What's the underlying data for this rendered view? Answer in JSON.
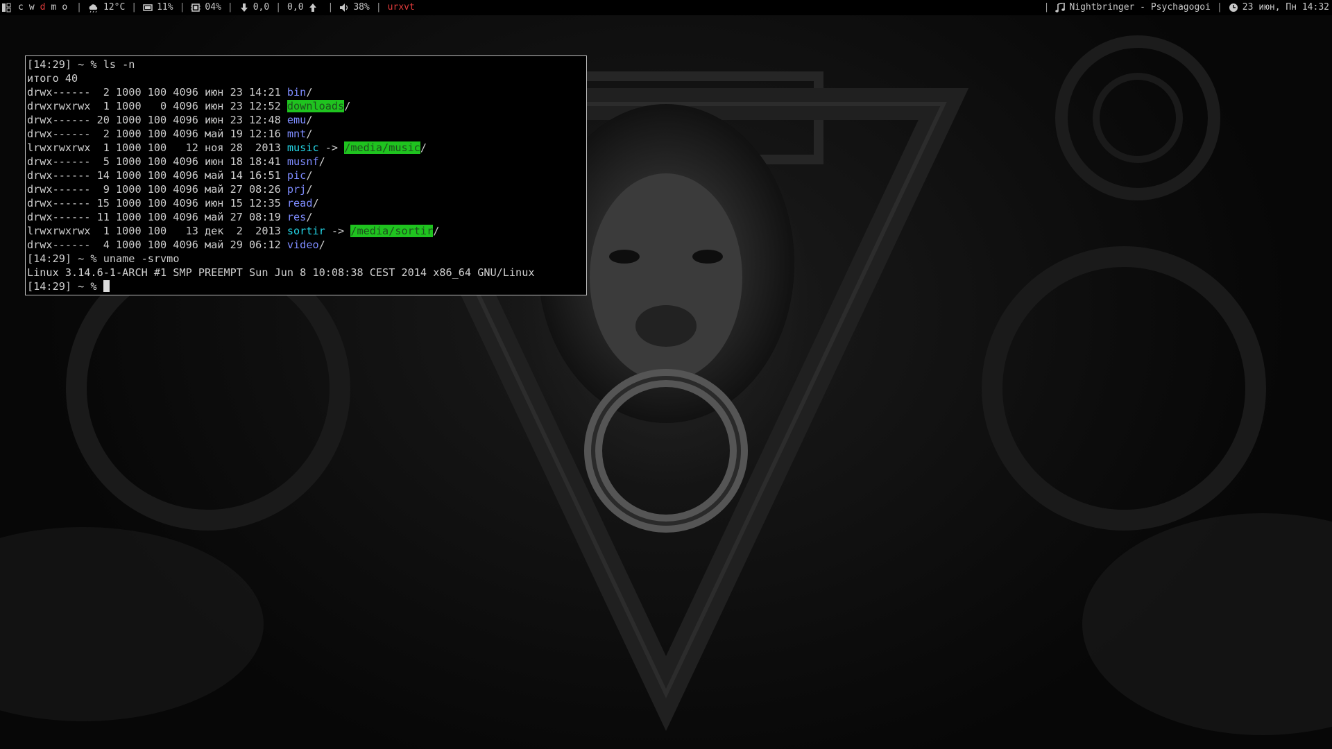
{
  "topbar": {
    "workspaces": [
      {
        "label": "c",
        "active": false
      },
      {
        "label": "w",
        "active": false
      },
      {
        "label": "d",
        "active": true
      },
      {
        "label": "m",
        "active": false
      },
      {
        "label": "o",
        "active": false
      }
    ],
    "temperature": "12°C",
    "cpu": "11%",
    "mem": "04%",
    "net_down": "0,0",
    "net_up": "0,0",
    "volume": "38%",
    "window_title": "urxvt",
    "now_playing": "Nightbringer - Psychagogoi",
    "datetime": "23 июн, Пн 14:32",
    "separator": "|",
    "icons": {
      "layout": "layout-icon",
      "weather": "weather-cloud-icon",
      "cpu": "cpu-icon",
      "mem": "memory-icon",
      "down": "arrow-down-icon",
      "up": "arrow-up-icon",
      "volume": "speaker-icon",
      "music": "music-note-icon",
      "clock": "clock-icon"
    },
    "colors": {
      "accent": "#e23c3c",
      "text": "#c8c8c8"
    }
  },
  "terminal": {
    "prompt1": "[14:29] ~ % ",
    "cmd1": "ls -n",
    "total": "итого 40",
    "entries": [
      {
        "meta": "drwx------  2 1000 100 4096 июн 23 14:21 ",
        "name": "bin",
        "kind": "dir",
        "suffix": "/"
      },
      {
        "meta": "drwxrwxrwx  1 1000   0 4096 июн 23 12:52 ",
        "name": "downloads",
        "kind": "hl",
        "suffix": "/"
      },
      {
        "meta": "drwx------ 20 1000 100 4096 июн 23 12:48 ",
        "name": "emu",
        "kind": "dir",
        "suffix": "/"
      },
      {
        "meta": "drwx------  2 1000 100 4096 май 19 12:16 ",
        "name": "mnt",
        "kind": "dir",
        "suffix": "/"
      },
      {
        "meta": "lrwxrwxrwx  1 1000 100   12 ноя 28  2013 ",
        "name": "music",
        "kind": "link",
        "arrow": " -> ",
        "target": "/media/music",
        "suffix": "/"
      },
      {
        "meta": "drwx------  5 1000 100 4096 июн 18 18:41 ",
        "name": "musnf",
        "kind": "dir",
        "suffix": "/"
      },
      {
        "meta": "drwx------ 14 1000 100 4096 май 14 16:51 ",
        "name": "pic",
        "kind": "dir",
        "suffix": "/"
      },
      {
        "meta": "drwx------  9 1000 100 4096 май 27 08:26 ",
        "name": "prj",
        "kind": "dir",
        "suffix": "/"
      },
      {
        "meta": "drwx------ 15 1000 100 4096 июн 15 12:35 ",
        "name": "read",
        "kind": "dir",
        "suffix": "/"
      },
      {
        "meta": "drwx------ 11 1000 100 4096 май 27 08:19 ",
        "name": "res",
        "kind": "dir",
        "suffix": "/"
      },
      {
        "meta": "lrwxrwxrwx  1 1000 100   13 дек  2  2013 ",
        "name": "sortir",
        "kind": "link",
        "arrow": " -> ",
        "target": "/media/sortir",
        "suffix": "/"
      },
      {
        "meta": "drwx------  4 1000 100 4096 май 29 06:12 ",
        "name": "video",
        "kind": "dir",
        "suffix": "/"
      }
    ],
    "prompt2": "[14:29] ~ % ",
    "cmd2": "uname -srvmo",
    "uname_output": "Linux 3.14.6-1-ARCH #1 SMP PREEMPT Sun Jun 8 10:08:38 CEST 2014 x86_64 GNU/Linux",
    "prompt3": "[14:29] ~ % ",
    "colors": {
      "dir": "#7e8cff",
      "link": "#24d7e8",
      "highlight_bg": "#1fc31f"
    }
  }
}
